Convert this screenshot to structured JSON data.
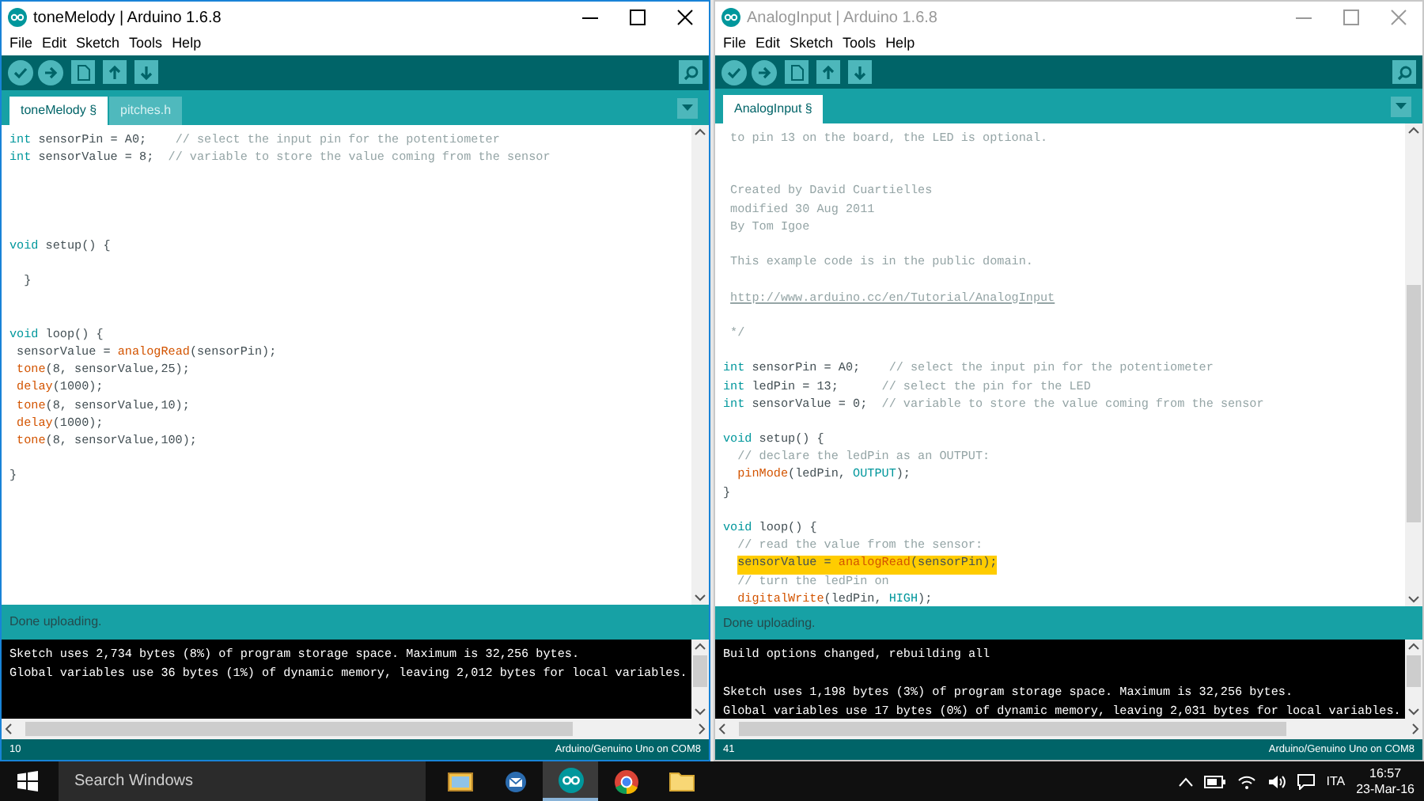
{
  "windows": [
    {
      "title": "toneMelody | Arduino 1.6.8",
      "active": true,
      "menu": [
        "File",
        "Edit",
        "Sketch",
        "Tools",
        "Help"
      ],
      "tabs": [
        {
          "label": "toneMelody §",
          "selected": true
        },
        {
          "label": "pitches.h",
          "selected": false
        }
      ],
      "editor": {
        "scrollbar_thumb": false,
        "lines": [
          {
            "kind": "code",
            "highlighted": false,
            "segments": [
              {
                "kind": "keyword",
                "text": "int"
              },
              {
                "kind": "plain",
                "text": " sensorPin = A0;    "
              },
              {
                "kind": "comment",
                "text": "// select the input pin for the potentiometer"
              }
            ]
          },
          {
            "kind": "code",
            "highlighted": false,
            "segments": [
              {
                "kind": "keyword",
                "text": "int"
              },
              {
                "kind": "plain",
                "text": " sensorValue = 8;  "
              },
              {
                "kind": "comment",
                "text": "// variable to store the value coming from the sensor"
              }
            ]
          },
          {
            "kind": "blank"
          },
          {
            "kind": "blank"
          },
          {
            "kind": "blank"
          },
          {
            "kind": "blank"
          },
          {
            "kind": "code",
            "highlighted": false,
            "segments": [
              {
                "kind": "keyword",
                "text": "void"
              },
              {
                "kind": "plain",
                "text": " setup() {"
              }
            ]
          },
          {
            "kind": "blank"
          },
          {
            "kind": "code",
            "highlighted": false,
            "segments": [
              {
                "kind": "plain",
                "text": "  }"
              }
            ]
          },
          {
            "kind": "blank"
          },
          {
            "kind": "blank"
          },
          {
            "kind": "code",
            "highlighted": false,
            "segments": [
              {
                "kind": "keyword",
                "text": "void"
              },
              {
                "kind": "plain",
                "text": " loop() {"
              }
            ]
          },
          {
            "kind": "code",
            "highlighted": false,
            "segments": [
              {
                "kind": "plain",
                "text": " sensorValue = "
              },
              {
                "kind": "function",
                "text": "analogRead"
              },
              {
                "kind": "plain",
                "text": "(sensorPin);"
              }
            ]
          },
          {
            "kind": "code",
            "highlighted": false,
            "segments": [
              {
                "kind": "function",
                "text": " tone"
              },
              {
                "kind": "plain",
                "text": "(8, sensorValue,25);"
              }
            ]
          },
          {
            "kind": "code",
            "highlighted": false,
            "segments": [
              {
                "kind": "function",
                "text": " delay"
              },
              {
                "kind": "plain",
                "text": "(1000);"
              }
            ]
          },
          {
            "kind": "code",
            "highlighted": false,
            "segments": [
              {
                "kind": "function",
                "text": " tone"
              },
              {
                "kind": "plain",
                "text": "(8, sensorValue,10);"
              }
            ]
          },
          {
            "kind": "code",
            "highlighted": false,
            "segments": [
              {
                "kind": "function",
                "text": " delay"
              },
              {
                "kind": "plain",
                "text": "(1000);"
              }
            ]
          },
          {
            "kind": "code",
            "highlighted": false,
            "segments": [
              {
                "kind": "function",
                "text": " tone"
              },
              {
                "kind": "plain",
                "text": "(8, sensorValue,100);"
              }
            ]
          },
          {
            "kind": "blank"
          },
          {
            "kind": "code",
            "highlighted": false,
            "segments": [
              {
                "kind": "plain",
                "text": "}"
              }
            ]
          }
        ]
      },
      "status": "Done uploading.",
      "console": [
        [
          "Sketch uses 2,734 bytes (8%) of program storage space. Maximum is 32,256 bytes.",
          "Global variables use 36 bytes (1%) of dynamic memory, leaving 2,012 bytes for local variables."
        ]
      ],
      "footer": {
        "line": "10",
        "board": "Arduino/Genuino Uno on COM8"
      }
    },
    {
      "title": "AnalogInput | Arduino 1.6.8",
      "active": false,
      "menu": [
        "File",
        "Edit",
        "Sketch",
        "Tools",
        "Help"
      ],
      "tabs": [
        {
          "label": "AnalogInput §",
          "selected": true
        }
      ],
      "editor": {
        "scrollbar_thumb": true,
        "lines": [
          {
            "kind": "code",
            "highlighted": false,
            "segments": [
              {
                "kind": "comment",
                "text": " to pin 13 on the board, the LED is optional."
              }
            ]
          },
          {
            "kind": "blank"
          },
          {
            "kind": "blank"
          },
          {
            "kind": "code",
            "highlighted": false,
            "segments": [
              {
                "kind": "comment",
                "text": " Created by David Cuartielles"
              }
            ]
          },
          {
            "kind": "code",
            "highlighted": false,
            "segments": [
              {
                "kind": "comment",
                "text": " modified 30 Aug 2011"
              }
            ]
          },
          {
            "kind": "code",
            "highlighted": false,
            "segments": [
              {
                "kind": "comment",
                "text": " By Tom Igoe"
              }
            ]
          },
          {
            "kind": "blank"
          },
          {
            "kind": "code",
            "highlighted": false,
            "segments": [
              {
                "kind": "comment",
                "text": " This example code is in the public domain."
              }
            ]
          },
          {
            "kind": "blank"
          },
          {
            "kind": "code",
            "highlighted": false,
            "segments": [
              {
                "kind": "link",
                "text": " http://www.arduino.cc/en/Tutorial/AnalogInput"
              }
            ]
          },
          {
            "kind": "blank"
          },
          {
            "kind": "code",
            "highlighted": false,
            "segments": [
              {
                "kind": "comment",
                "text": " */"
              }
            ]
          },
          {
            "kind": "blank"
          },
          {
            "kind": "code",
            "highlighted": false,
            "segments": [
              {
                "kind": "keyword",
                "text": "int"
              },
              {
                "kind": "plain",
                "text": " sensorPin = A0;    "
              },
              {
                "kind": "comment",
                "text": "// select the input pin for the potentiometer"
              }
            ]
          },
          {
            "kind": "code",
            "highlighted": false,
            "segments": [
              {
                "kind": "keyword",
                "text": "int"
              },
              {
                "kind": "plain",
                "text": " ledPin = 13;      "
              },
              {
                "kind": "comment",
                "text": "// select the pin for the LED"
              }
            ]
          },
          {
            "kind": "code",
            "highlighted": false,
            "segments": [
              {
                "kind": "keyword",
                "text": "int"
              },
              {
                "kind": "plain",
                "text": " sensorValue = 0;  "
              },
              {
                "kind": "comment",
                "text": "// variable to store the value coming from the sensor"
              }
            ]
          },
          {
            "kind": "blank"
          },
          {
            "kind": "code",
            "highlighted": false,
            "segments": [
              {
                "kind": "keyword",
                "text": "void"
              },
              {
                "kind": "plain",
                "text": " setup() {"
              }
            ]
          },
          {
            "kind": "code",
            "highlighted": false,
            "segments": [
              {
                "kind": "comment",
                "text": "  // declare the ledPin as an OUTPUT:"
              }
            ]
          },
          {
            "kind": "code",
            "highlighted": false,
            "segments": [
              {
                "kind": "function",
                "text": "  pinMode"
              },
              {
                "kind": "plain",
                "text": "(ledPin, "
              },
              {
                "kind": "constant",
                "text": "OUTPUT"
              },
              {
                "kind": "plain",
                "text": ");"
              }
            ]
          },
          {
            "kind": "code",
            "highlighted": false,
            "segments": [
              {
                "kind": "plain",
                "text": "}"
              }
            ]
          },
          {
            "kind": "blank"
          },
          {
            "kind": "code",
            "highlighted": false,
            "segments": [
              {
                "kind": "keyword",
                "text": "void"
              },
              {
                "kind": "plain",
                "text": " loop() {"
              }
            ]
          },
          {
            "kind": "code",
            "highlighted": false,
            "segments": [
              {
                "kind": "comment",
                "text": "  // read the value from the sensor:"
              }
            ]
          },
          {
            "kind": "code",
            "highlighted": true,
            "segments": [
              {
                "kind": "plain",
                "text": "  sensorValue = "
              },
              {
                "kind": "function",
                "text": "analogRead"
              },
              {
                "kind": "plain",
                "text": "(sensorPin);"
              }
            ]
          },
          {
            "kind": "code",
            "highlighted": false,
            "segments": [
              {
                "kind": "comment",
                "text": "  // turn the ledPin on"
              }
            ]
          },
          {
            "kind": "code",
            "highlighted": false,
            "segments": [
              {
                "kind": "function",
                "text": "  digitalWrite"
              },
              {
                "kind": "plain",
                "text": "(ledPin, "
              },
              {
                "kind": "constant",
                "text": "HIGH"
              },
              {
                "kind": "plain",
                "text": ");"
              }
            ]
          }
        ]
      },
      "status": "Done uploading.",
      "console": [
        [
          "Build options changed, rebuilding all"
        ],
        [
          "Sketch uses 1,198 bytes (3%) of program storage space. Maximum is 32,256 bytes.",
          "Global variables use 17 bytes (0%) of dynamic memory, leaving 2,031 bytes for local variables."
        ]
      ],
      "footer": {
        "line": "41",
        "board": "Arduino/Genuino Uno on COM8"
      }
    }
  ],
  "taskbar": {
    "search": {
      "placeholder": "Search Windows"
    },
    "apps": [
      {
        "kind": "photos",
        "selected": false
      },
      {
        "kind": "mail",
        "selected": false
      },
      {
        "kind": "arduino",
        "selected": true
      },
      {
        "kind": "browser",
        "selected": false
      },
      {
        "kind": "folder",
        "selected": false
      }
    ],
    "language": "ITA",
    "time": "16:57",
    "date": "23-Mar-16"
  }
}
